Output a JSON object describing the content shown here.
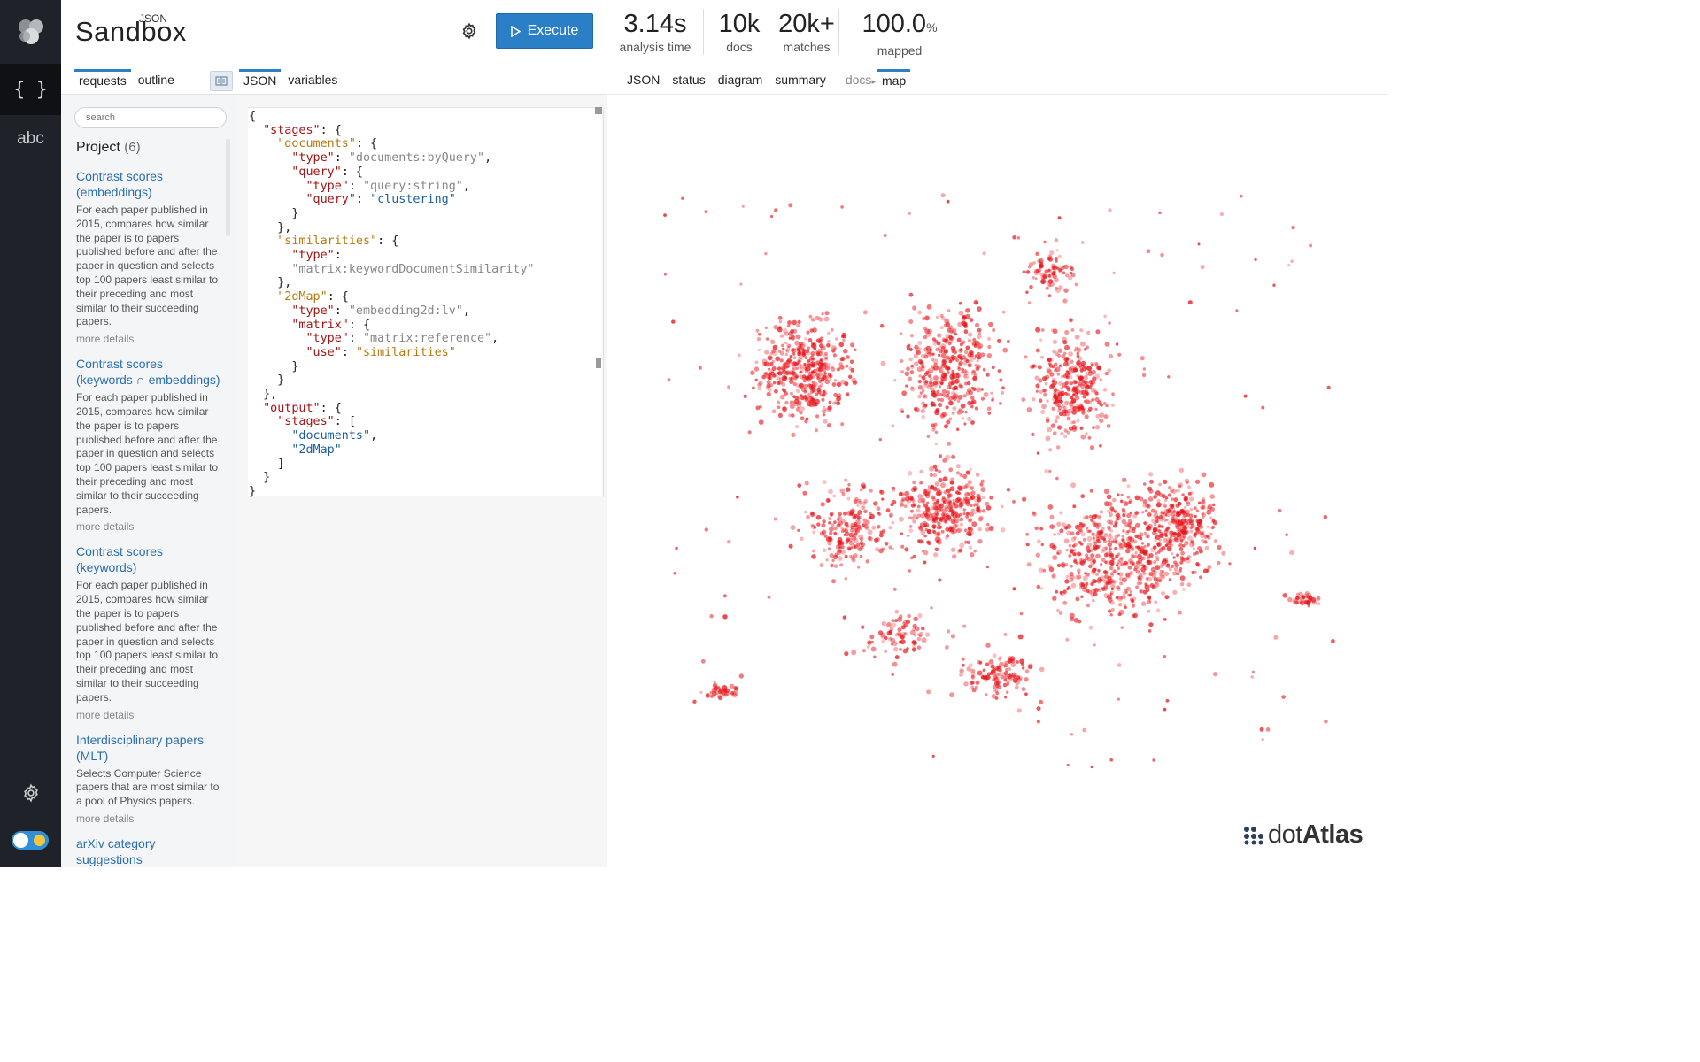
{
  "app": {
    "brand": "Sandbox",
    "brand_super": "JSON",
    "execute_label": "Execute",
    "rail": {
      "json_glyph": "{ }",
      "text_glyph": "abc"
    }
  },
  "stats": [
    {
      "value": "3.14s",
      "unit": "",
      "label": "analysis time"
    },
    {
      "value": "10k",
      "unit": "",
      "label": "docs"
    },
    {
      "value": "20k+",
      "unit": "",
      "label": "matches"
    },
    {
      "value": "100.0",
      "unit": "%",
      "label": "mapped"
    }
  ],
  "left_tabs": [
    "requests",
    "outline"
  ],
  "editor_tabs": [
    "JSON",
    "variables"
  ],
  "result_tabs": [
    "JSON",
    "status",
    "diagram",
    "summary",
    "docs",
    "map"
  ],
  "search": {
    "placeholder": "search"
  },
  "project": {
    "title": "Project",
    "count": "(6)",
    "items": [
      {
        "name": "Contrast scores (embeddings)",
        "desc": "For each paper published in 2015, compares how similar the paper is to papers published before and after the paper in question and selects top 100 papers least similar to their preceding and most similar to their succeeding papers.",
        "more": "more details"
      },
      {
        "name": "Contrast scores (keywords ∩ embeddings)",
        "desc": "For each paper published in 2015, compares how similar the paper is to papers published before and after the paper in question and selects top 100 papers least similar to their preceding and most similar to their succeeding papers.",
        "more": "more details"
      },
      {
        "name": "Contrast scores (keywords)",
        "desc": "For each paper published in 2015, compares how similar the paper is to papers published before and after the paper in question and selects top 100 papers least similar to their preceding and most similar to their succeeding papers.",
        "more": "more details"
      },
      {
        "name": "Interdisciplinary papers (MLT)",
        "desc": "Selects Computer Science papers that are most similar to a pool of Physics papers.",
        "more": "more details"
      },
      {
        "name": "arXiv category suggestions",
        "desc": "",
        "more": ""
      }
    ]
  },
  "code": {
    "stages_key": "\"stages\"",
    "documents_key": "\"documents\"",
    "type_key": "\"type\"",
    "query_key": "\"query\"",
    "similarities_key": "\"similarities\"",
    "map_key": "\"2dMap\"",
    "matrix_key": "\"matrix\"",
    "use_key": "\"use\"",
    "output_key": "\"output\"",
    "v_docs_by_query": "\"documents:byQuery\"",
    "v_query_string": "\"query:string\"",
    "v_clustering": "\"clustering\"",
    "v_kw_sim": "\"matrix:keywordDocumentSimilarity\"",
    "v_embedding": "\"embedding2d:lv\"",
    "v_reference": "\"matrix:reference\"",
    "v_similarities": "\"similarities\"",
    "v_documents": "\"documents\"",
    "v_2dmap": "\"2dMap\""
  },
  "map": {
    "dot_color": "#e8141a",
    "logo_text_bold": "dot",
    "logo_text": "Atlas"
  },
  "colors": {
    "accent": "#2a7fc6",
    "rail": "#1f2329"
  }
}
